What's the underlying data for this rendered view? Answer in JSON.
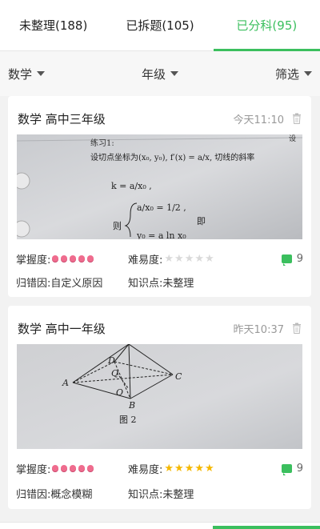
{
  "tabs": [
    {
      "label": "未整理(188)",
      "active": false
    },
    {
      "label": "已拆题(105)",
      "active": false
    },
    {
      "label": "已分科(95)",
      "active": true
    }
  ],
  "filters": {
    "subject": "数学",
    "grade": "年级",
    "filter": "筛选"
  },
  "cards": [
    {
      "title": "数学  高中三年级",
      "time": "今天11:10",
      "mastery_label": "掌握度:",
      "mastery_level": 5,
      "difficulty_label": "难易度:",
      "difficulty_stars": 0,
      "comment_count": "9",
      "error_reason_label": "归错因:",
      "error_reason": "自定义原因",
      "knowledge_label": "知识点:",
      "knowledge": "未整理",
      "photo_text": {
        "heading": "练习1:",
        "line1": "设切点坐标为(x₀, y₀), f′(x) = a/x, 切线的斜率",
        "line2": "k = a/x₀ ,",
        "line3": "a/x₀ = 1/2 ,",
        "line4": "则",
        "line5": "即",
        "line6": "y₀ = a ln x₀",
        "corner": "设"
      }
    },
    {
      "title": "数学  高中一年级",
      "time": "昨天10:37",
      "mastery_label": "掌握度:",
      "mastery_level": 5,
      "difficulty_label": "难易度:",
      "difficulty_stars": 5,
      "comment_count": "9",
      "error_reason_label": "归错因:",
      "error_reason": "概念模糊",
      "knowledge_label": "知识点:",
      "knowledge": "未整理",
      "photo_text": {
        "A": "A",
        "B": "B",
        "C": "C",
        "D": "D",
        "Q": "Q",
        "O": "O",
        "caption": "图 2"
      }
    }
  ],
  "colors": {
    "accent": "#3bbf5e",
    "mastery_dot": "#ef6c8e",
    "star_on": "#f5b800",
    "star_off": "#d9d9d9"
  }
}
